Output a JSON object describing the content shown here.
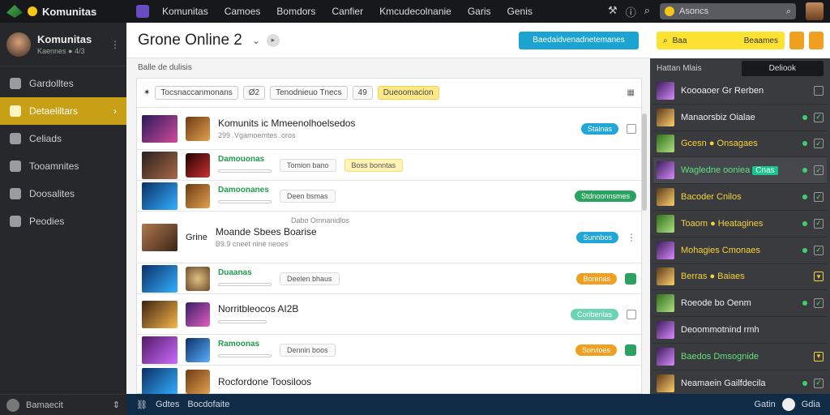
{
  "topbar": {
    "brand": "Komunitas",
    "nav": [
      "Komunitas",
      "Camoes",
      "Bomdors",
      "Canfier",
      "Kmcudecolnanie",
      "Garis",
      "Genis"
    ],
    "search_placeholder": "Asoncs"
  },
  "sidebar": {
    "profile_name": "Komunitas",
    "profile_sub": "Kaennes ● 4/3",
    "items": [
      {
        "label": "Gardolltes"
      },
      {
        "label": "Detaeliltars"
      },
      {
        "label": "Celiads"
      },
      {
        "label": "Tooamnites"
      },
      {
        "label": "Doosalites"
      },
      {
        "label": "Peodies"
      }
    ],
    "footer": "Bamaecit"
  },
  "main": {
    "title": "Grone Online 2",
    "cta": "Baedaidvenadnetemanes",
    "section_label": "Balle de dulisis",
    "filters": [
      "Tocsnaccanmonans",
      "Ø2",
      "Tenodnieuo Tnecs",
      "49",
      "Dueoomacion"
    ],
    "rows": [
      {
        "name": "Komunits ic Mmeenolhoelsedos",
        "meta": "299 .Vgamoemtes .oros",
        "pill": "Stalnas"
      },
      {
        "name": "Damouonas",
        "chip1": "Tomion bano",
        "chip2": "Boss bonntas"
      },
      {
        "name": "Damoonanes",
        "chip1": "Deen bsmas",
        "pill": "Stdnoonnsmes"
      },
      {
        "caption": "Dabo Omnanidlos",
        "label": "Grine",
        "name": "Moande Sbees Boarise",
        "meta": "B9.9 cneet nine neoes",
        "pill": "Sunnbos"
      },
      {
        "name": "Duaanas",
        "chip1": "Deelen bhaus",
        "pill": "Borenas"
      },
      {
        "name": "Norritbleocos AI2B",
        "pill": "Coribenlas"
      },
      {
        "name": "Ramoonas",
        "chip1": "Dennin boos",
        "pill": "Sorvioes"
      },
      {
        "name": "Rocfordone Toosiloos"
      }
    ]
  },
  "rightpanel": {
    "search_label": "Baa",
    "search_value": "Beaames",
    "tab1": "Hattan Mlais",
    "tab2": "Deliook",
    "players": [
      {
        "name": "Koooaoer Gr Rerben"
      },
      {
        "name": "Manaorsbiz Oialae"
      },
      {
        "name": "Gcesn ● Onsagaes"
      },
      {
        "name": "Wagledne ooniea",
        "tag": "Cnas"
      },
      {
        "name": "Bacoder Cnilos"
      },
      {
        "name": "Toaom ● Heatagines"
      },
      {
        "name": "Mohagies Cmonaes"
      },
      {
        "name": "Berras ● Baiaes"
      },
      {
        "name": "Roeode bo Oenm"
      },
      {
        "name": "Deoommotnind rmh"
      },
      {
        "name": "Baedos Dmsognide"
      },
      {
        "name": "Neamaein Gailfdecila"
      }
    ]
  },
  "footer": {
    "left1": "Gdtes",
    "left2": "Bocdofaite",
    "right1": "Gatin",
    "right2": "Gdia"
  }
}
